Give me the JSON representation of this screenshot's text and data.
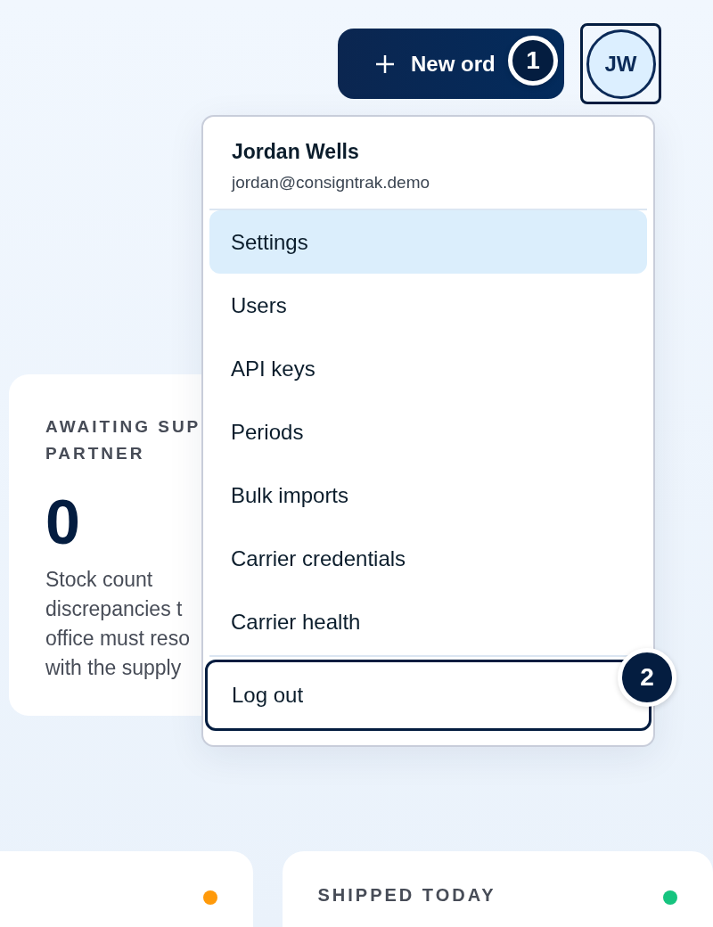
{
  "header": {
    "new_order_button": {
      "label": "New ord",
      "callout": "1"
    },
    "avatar": {
      "initials": "JW",
      "selected": true
    }
  },
  "user_menu": {
    "name": "Jordan Wells",
    "email": "jordan@consigntrak.demo",
    "items": [
      {
        "label": "Settings",
        "selected": true
      },
      {
        "label": "Users",
        "selected": false
      },
      {
        "label": "API keys",
        "selected": false
      },
      {
        "label": "Periods",
        "selected": false
      },
      {
        "label": "Bulk imports",
        "selected": false
      },
      {
        "label": "Carrier credentials",
        "selected": false
      },
      {
        "label": "Carrier health",
        "selected": false
      }
    ],
    "logout": {
      "label": "Log out",
      "focused": true,
      "callout": "2"
    }
  },
  "stat_card": {
    "title_lines": [
      "AWAITING SUP",
      "PARTNER"
    ],
    "value": "0",
    "description_lines": [
      "Stock count",
      "discrepancies t",
      "office must reso",
      "with the supply"
    ]
  },
  "bottom_cards": [
    {
      "color": "#ff9a0a"
    },
    {
      "title": "SHIPPED TODAY",
      "color": "#16c47f"
    }
  ]
}
